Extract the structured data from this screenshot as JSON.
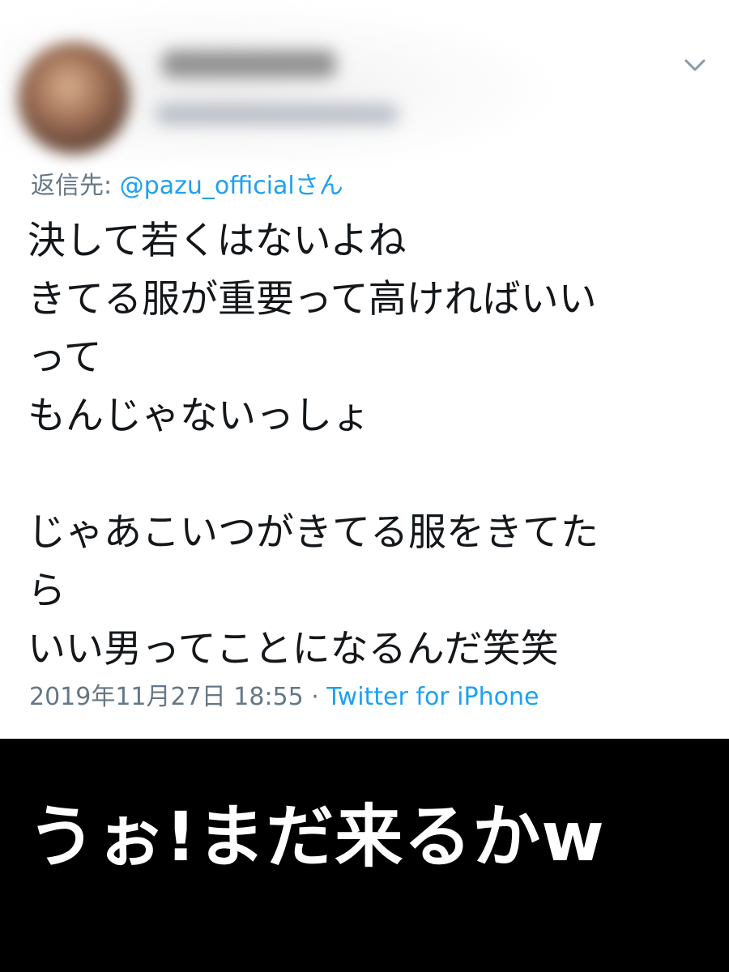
{
  "tweet": {
    "reply_to_prefix": "返信先: ",
    "reply_to_handle": "@pazu_official",
    "reply_to_suffix": "さん",
    "lines": [
      "決して若くはないよね",
      "きてる服が重要って高ければいい",
      "って",
      "もんじゃないっしょ",
      "",
      "じゃあこいつがきてる服をきてた",
      "ら",
      "いい男ってことになるんだ笑笑"
    ],
    "timestamp": "2019年11月27日 18:55",
    "separator": " · ",
    "source": "Twitter for iPhone"
  },
  "caption": {
    "text": "うぉ!まだ来るかw"
  },
  "icons": {
    "chevron": "chevron-down-icon",
    "avatar": "avatar"
  },
  "colors": {
    "text_primary": "#14171a",
    "text_secondary": "#657786",
    "link": "#1da1f2",
    "caption_background": "#000000",
    "caption_text": "#ffffff"
  }
}
